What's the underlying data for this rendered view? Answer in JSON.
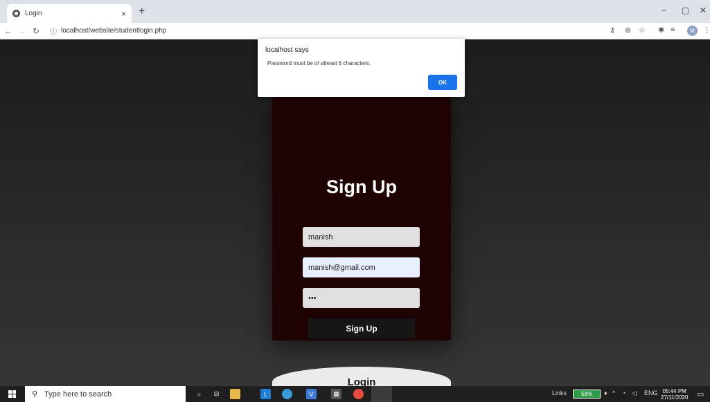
{
  "browser": {
    "tab_title": "Login",
    "tab_close": "×",
    "new_tab": "+",
    "url": "localhost/website/studentlogin.php",
    "avatar_letter": "M",
    "window_controls": {
      "minimize": "−",
      "restore": "▢",
      "close": "✕"
    }
  },
  "alert": {
    "title": "localhost says",
    "message": "Password must be of atleast 6 characters.",
    "ok_label": "OK"
  },
  "form": {
    "heading": "Sign Up",
    "username_value": "manish",
    "email_value": "manish@gmail.com",
    "password_value": "•••",
    "submit_label": "Sign Up",
    "login_label": "Login"
  },
  "taskbar": {
    "search_placeholder": "Type here to search",
    "links_label": "Links",
    "battery_percent": "58%",
    "language": "ENG",
    "time": "05:44 PM",
    "date": "27/11/2020"
  },
  "colors": {
    "card_bg": "#1f0303",
    "alert_ok": "#1a73e8",
    "battery": "#2d9c46"
  }
}
